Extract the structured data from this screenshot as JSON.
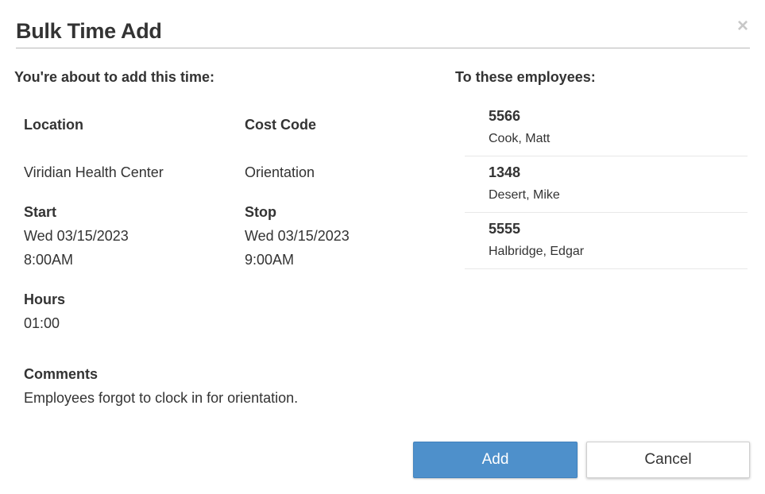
{
  "dialog": {
    "title": "Bulk Time Add",
    "close_symbol": "×"
  },
  "summary": {
    "heading": "You're about to add this time:",
    "location_label": "Location",
    "location_value": "Viridian Health Center",
    "cost_code_label": "Cost Code",
    "cost_code_value": "Orientation",
    "start_label": "Start",
    "start_date": "Wed 03/15/2023",
    "start_time": "8:00AM",
    "stop_label": "Stop",
    "stop_date": "Wed 03/15/2023",
    "stop_time": "9:00AM",
    "hours_label": "Hours",
    "hours_value": "01:00",
    "comments_label": "Comments",
    "comments_value": "Employees forgot to clock in for orientation."
  },
  "employees": {
    "heading": "To these employees:",
    "items": [
      {
        "id": "5566",
        "name": "Cook, Matt"
      },
      {
        "id": "1348",
        "name": "Desert, Mike"
      },
      {
        "id": "5555",
        "name": "Halbridge, Edgar"
      }
    ]
  },
  "actions": {
    "add_label": "Add",
    "cancel_label": "Cancel"
  },
  "colors": {
    "primary": "#4e90cb",
    "text": "#333333",
    "divider": "#b8b8b8"
  }
}
